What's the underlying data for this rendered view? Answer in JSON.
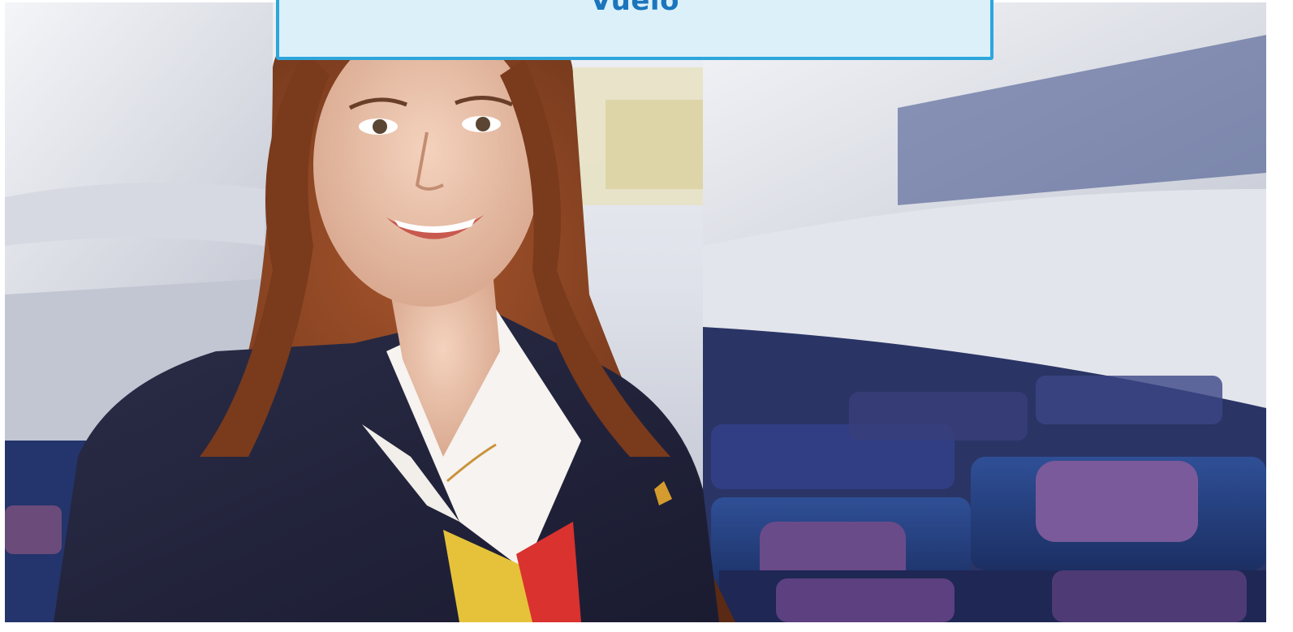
{
  "slide": {
    "title": "Vuelo"
  },
  "photo": {
    "subject": "flight-attendant-in-aircraft-cabin"
  },
  "colors": {
    "title_fill": "#dcf0fa",
    "title_border": "#2ea6dc",
    "title_text": "#1b75bc"
  }
}
